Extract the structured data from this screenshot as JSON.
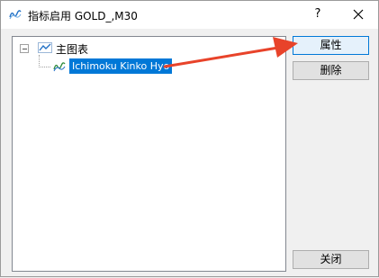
{
  "window": {
    "title": "指标启用 GOLD_,M30",
    "help_label": "?"
  },
  "tree": {
    "root_label": "主图表",
    "child_label": "Ichimoku Kinko Hyo"
  },
  "buttons": {
    "properties": "属性",
    "delete": "删除",
    "close": "关闭"
  },
  "annotation": {
    "arrow_color": "#e8432a"
  },
  "colors": {
    "selection": "#0078d7",
    "accent_icon": "#1f6fc5",
    "button_focus": "#0078d7"
  },
  "icons": {
    "title": "indicator-icon",
    "root": "chart-line-icon",
    "child": "indicator-icon",
    "close": "close-icon",
    "help": "help-icon"
  }
}
